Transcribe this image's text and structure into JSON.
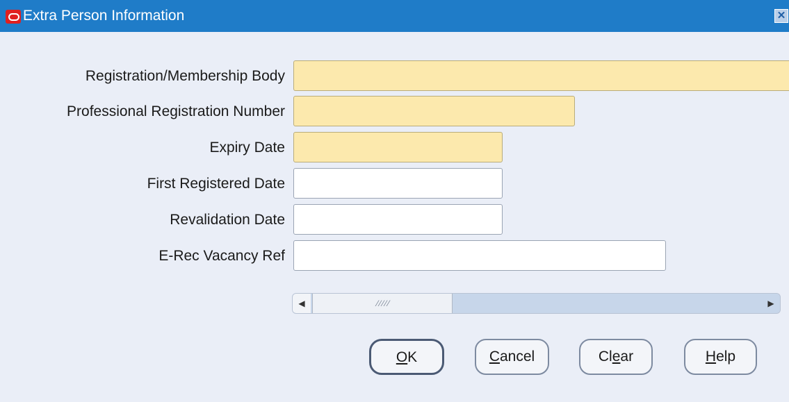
{
  "window": {
    "title": "Extra Person Information",
    "close_glyph": "✕"
  },
  "fields": [
    {
      "label": "Registration/Membership Body",
      "value": ""
    },
    {
      "label": "Professional Registration Number",
      "value": ""
    },
    {
      "label": "Expiry Date",
      "value": ""
    },
    {
      "label": "First Registered Date",
      "value": ""
    },
    {
      "label": "Revalidation Date",
      "value": ""
    },
    {
      "label": "E-Rec Vacancy Ref",
      "value": ""
    }
  ],
  "scrollbar": {
    "left_arrow": "◀",
    "right_arrow": "▶",
    "grip": "⁄⁄⁄⁄⁄"
  },
  "buttons": {
    "ok_mn": "O",
    "ok_rest": "K",
    "cancel_mn": "C",
    "cancel_rest": "ancel",
    "clear_pre": "Cl",
    "clear_mn": "e",
    "clear_rest": "ar",
    "help_mn": "H",
    "help_rest": "elp"
  },
  "colors": {
    "titlebar": "#1f7cc8",
    "required_field": "#fce9ad",
    "background": "#eaeef7"
  }
}
